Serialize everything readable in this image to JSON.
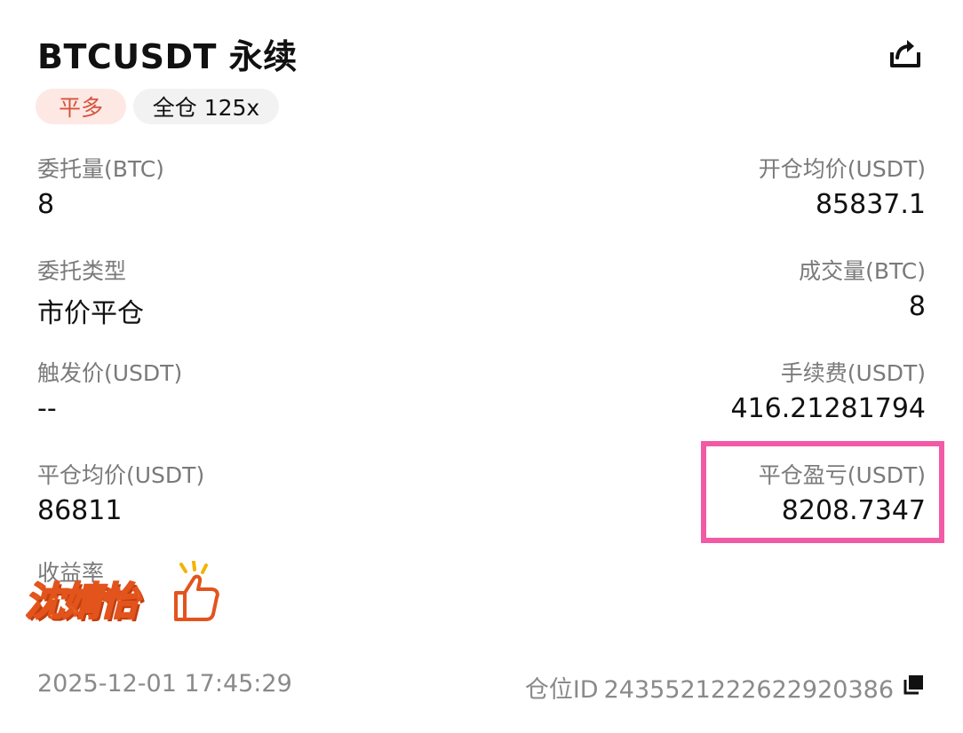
{
  "header": {
    "title": "BTCUSDT 永续",
    "share_icon": "share-icon"
  },
  "tags": {
    "side": "平多",
    "margin_mode": "全仓 125x"
  },
  "colors": {
    "side_tag_bg": "#fde8e4",
    "side_tag_text": "#d4553e",
    "margin_tag_bg": "#f2f2f2",
    "highlight_border": "#f25aa6",
    "label_gray": "#7a7a7a"
  },
  "fields": {
    "order_qty_label": "委托量(BTC)",
    "order_qty_value": "8",
    "open_avg_label": "开仓均价(USDT)",
    "open_avg_value": "85837.1",
    "order_type_label": "委托类型",
    "order_type_value": "市价平仓",
    "filled_qty_label": "成交量(BTC)",
    "filled_qty_value": "8",
    "trigger_price_label": "触发价(USDT)",
    "trigger_price_value": "--",
    "fee_label": "手续费(USDT)",
    "fee_value": "416.21281794",
    "close_avg_label": "平仓均价(USDT)",
    "close_avg_value": "86811",
    "close_pnl_label": "平仓盈亏(USDT)",
    "close_pnl_value": "8208.7347",
    "roi_label": "收益率"
  },
  "sticker": {
    "text": "沈婧怡",
    "icon": "thumbs-up-icon"
  },
  "footer": {
    "timestamp": "2025-12-01 17:45:29",
    "position_id_label": "仓位ID",
    "position_id_value": "2435521222622920386",
    "copy_icon": "copy-icon"
  }
}
